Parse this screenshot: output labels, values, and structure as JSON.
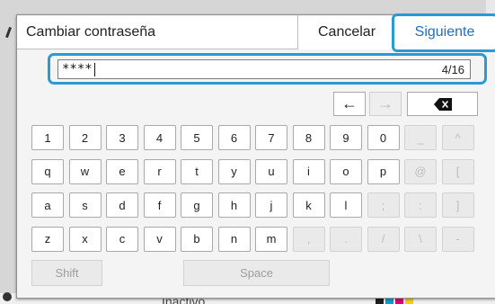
{
  "dialog": {
    "title": "Cambiar contraseña",
    "cancel_label": "Cancelar",
    "next_label": "Siguiente"
  },
  "input": {
    "value": "****",
    "counter": "4/16"
  },
  "background": {
    "status_text": "Inactivo"
  },
  "colors": {
    "accent": "#2a9ad6",
    "next_text": "#1a6fc6"
  },
  "keyboard": {
    "left_arrow": "←",
    "right_arrow": "→",
    "backspace": "backspace-icon",
    "rows": [
      [
        "1",
        "2",
        "3",
        "4",
        "5",
        "6",
        "7",
        "8",
        "9",
        "0",
        "_",
        "^"
      ],
      [
        "q",
        "w",
        "e",
        "r",
        "t",
        "y",
        "u",
        "i",
        "o",
        "p",
        "@",
        "["
      ],
      [
        "a",
        "s",
        "d",
        "f",
        "g",
        "h",
        "j",
        "k",
        "l",
        ";",
        ":",
        "]"
      ],
      [
        "z",
        "x",
        "c",
        "v",
        "b",
        "n",
        "m",
        ",",
        ".",
        "/",
        "\\",
        "-"
      ]
    ],
    "disabled_from_col": [
      10,
      10,
      9,
      7
    ],
    "shift_label": "Shift",
    "space_label": "Space"
  }
}
